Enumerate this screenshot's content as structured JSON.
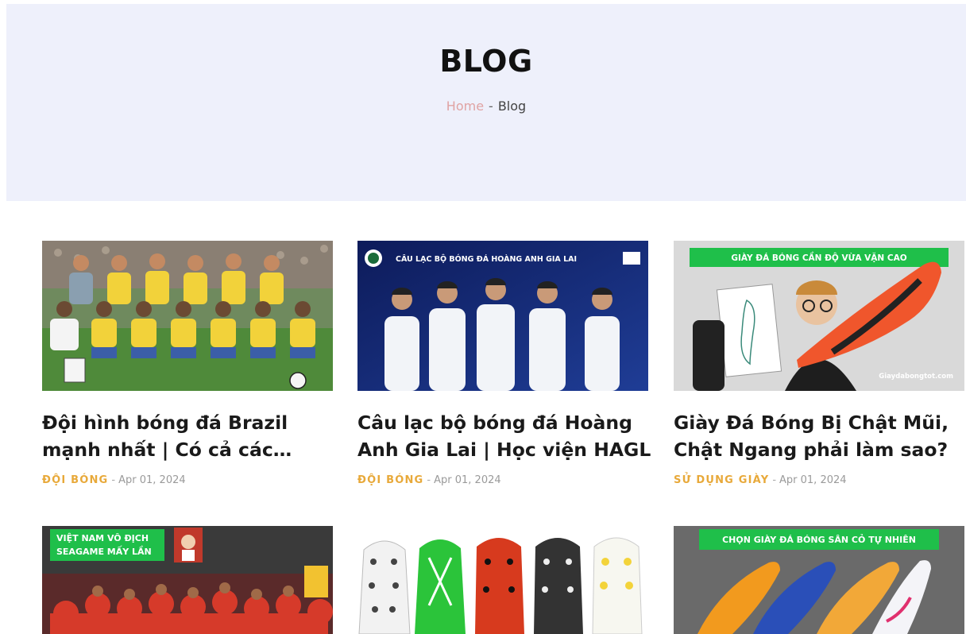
{
  "hero": {
    "title": "BLOG",
    "breadcrumb": {
      "home": "Home",
      "separator": "-",
      "current": "Blog"
    }
  },
  "colors": {
    "hero_bg": "#eef0fb",
    "category": "#e8a93a",
    "home_link": "#e0a3a3"
  },
  "posts": [
    {
      "title": "Đội hình bóng đá Brazil mạnh nhất | Có cả các huyền thoại",
      "category": "ĐỘI BÓNG",
      "date": "Apr 01, 2024",
      "image": "brazil-team-photo"
    },
    {
      "title": "Câu lạc bộ bóng đá Hoàng Anh Gia Lai | Học viện HAGL",
      "category": "ĐỘI BÓNG",
      "date": "Apr 01, 2024",
      "image": "hagl-players-photo",
      "banner": "CÂU LẠC BỘ BÓNG ĐÁ HOÀNG ANH GIA LAI"
    },
    {
      "title": "Giày Đá Bóng Bị Chật Mũi, Chật Ngang phải làm sao?",
      "category": "SỬ DỤNG GIÀY",
      "date": "Apr 01, 2024",
      "image": "tight-boots-photo",
      "banner": "GIÀY ĐÁ BÓNG CẦN ĐỘ VỪA VẶN CAO",
      "watermark": "Giaydabongtot.com"
    },
    {
      "image": "vietnam-seagame-photo",
      "banner_line1": "VIỆT NAM VÔ ĐỊCH",
      "banner_line2": "SEAGAME MẤY LẦN"
    },
    {
      "image": "boot-soles-photo"
    },
    {
      "image": "natural-grass-boots-photo",
      "banner": "CHỌN GIÀY ĐÁ BÓNG SÂN CỎ TỰ NHIÊN"
    }
  ]
}
